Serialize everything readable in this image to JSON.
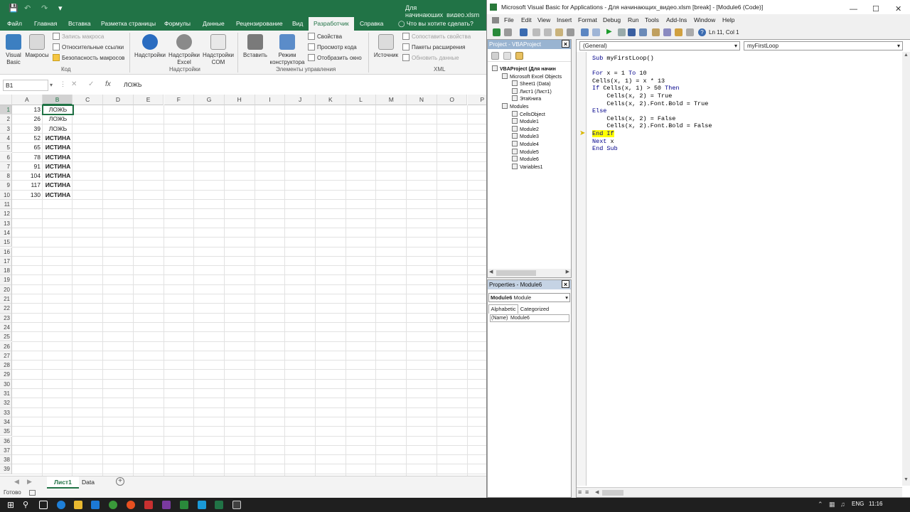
{
  "excel": {
    "doc_title": "Для начинающих_видео.xlsm",
    "tabs": [
      "Файл",
      "Главная",
      "Вставка",
      "Разметка страницы",
      "Формулы",
      "Данные",
      "Рецензирование",
      "Вид",
      "Разработчик",
      "Справка",
      "Что вы хотите сделать?"
    ],
    "active_tab": "Разработчик",
    "ribbon": {
      "visual_basic": "Visual Basic",
      "macros": "Макросы",
      "record_macro": "Запись макроса",
      "relative_refs": "Относительные ссылки",
      "macro_security": "Безопасность макросов",
      "group_code": "Код",
      "addins": "Надстройки",
      "excel_addins": "Надстройки Excel",
      "com_addins": "Надстройки COM",
      "group_addins": "Надстройки",
      "insert": "Вставить",
      "design_mode": "Режим конструктора",
      "properties": "Свойства",
      "view_code": "Просмотр кода",
      "run_dialog": "Отобразить окно",
      "group_controls": "Элементы управления",
      "source": "Источник",
      "map_props": "Сопоставить свойства",
      "expansion_packs": "Пакеты расширения",
      "refresh_data": "Обновить данные",
      "group_xml": "XML"
    },
    "name_box": "B1",
    "formula_value": "ЛОЖЬ",
    "columns": [
      "A",
      "B",
      "C",
      "D",
      "E",
      "F",
      "G",
      "H",
      "I",
      "J",
      "K",
      "L",
      "M",
      "N",
      "O",
      "P"
    ],
    "rows": [
      {
        "a": "13",
        "b": "ЛОЖЬ",
        "bold": false
      },
      {
        "a": "26",
        "b": "ЛОЖЬ",
        "bold": false
      },
      {
        "a": "39",
        "b": "ЛОЖЬ",
        "bold": false
      },
      {
        "a": "52",
        "b": "ИСТИНА",
        "bold": true
      },
      {
        "a": "65",
        "b": "ИСТИНА",
        "bold": true
      },
      {
        "a": "78",
        "b": "ИСТИНА",
        "bold": true
      },
      {
        "a": "91",
        "b": "ИСТИНА",
        "bold": true
      },
      {
        "a": "104",
        "b": "ИСТИНА",
        "bold": true
      },
      {
        "a": "117",
        "b": "ИСТИНА",
        "bold": true
      },
      {
        "a": "130",
        "b": "ИСТИНА",
        "bold": true
      }
    ],
    "row_count": 39,
    "sheets": [
      "Лист1",
      "Data"
    ],
    "active_sheet": "Лист1",
    "status": "Готово"
  },
  "vbe": {
    "title": "Microsoft Visual Basic for Applications - Для начинающих_видео.xlsm [break] - [Module6 (Code)]",
    "menu": [
      "File",
      "Edit",
      "View",
      "Insert",
      "Format",
      "Debug",
      "Run",
      "Tools",
      "Add-Ins",
      "Window",
      "Help"
    ],
    "ln_col": "Ln 11, Col 1",
    "project_title": "Project - VBAProject",
    "tree": [
      {
        "label": "VBAProject (Для начин",
        "level": 0,
        "bold": true
      },
      {
        "label": "Microsoft Excel Objects",
        "level": 1,
        "bold": false
      },
      {
        "label": "Sheet1 (Data)",
        "level": 2,
        "bold": false
      },
      {
        "label": "Лист1 (Лист1)",
        "level": 2,
        "bold": false
      },
      {
        "label": "ЭтаКнига",
        "level": 2,
        "bold": false
      },
      {
        "label": "Modules",
        "level": 1,
        "bold": false
      },
      {
        "label": "CellsObject",
        "level": 2,
        "bold": false
      },
      {
        "label": "Module1",
        "level": 2,
        "bold": false
      },
      {
        "label": "Module2",
        "level": 2,
        "bold": false
      },
      {
        "label": "Module3",
        "level": 2,
        "bold": false
      },
      {
        "label": "Module4",
        "level": 2,
        "bold": false
      },
      {
        "label": "Module5",
        "level": 2,
        "bold": false
      },
      {
        "label": "Module6",
        "level": 2,
        "bold": false
      },
      {
        "label": "Variables1",
        "level": 2,
        "bold": false
      }
    ],
    "props_title": "Properties - Module6",
    "props_object": "Module6",
    "props_object_type": "Module",
    "props_tabs": [
      "Alphabetic",
      "Categorized"
    ],
    "props_name_key": "(Name)",
    "props_name_val": "Module6",
    "general_dropdown": "(General)",
    "proc_dropdown": "myFirstLoop",
    "code": [
      "Sub myFirstLoop()",
      "",
      "For x = 1 To 10",
      "Cells(x, 1) = x * 13",
      "If Cells(x, 1) > 50 Then",
      "    Cells(x, 2) = True",
      "    Cells(x, 2).Font.Bold = True",
      "Else",
      "    Cells(x, 2) = False",
      "    Cells(x, 2).Font.Bold = False",
      "End If",
      "Next x",
      "End Sub"
    ],
    "highlight_line": 10
  },
  "taskbar": {
    "lang": "ENG",
    "time": "11:16"
  },
  "colors": {
    "excel_green": "#217346",
    "exec_highlight": "#ffff00",
    "vba_keyword": "#00008b"
  }
}
